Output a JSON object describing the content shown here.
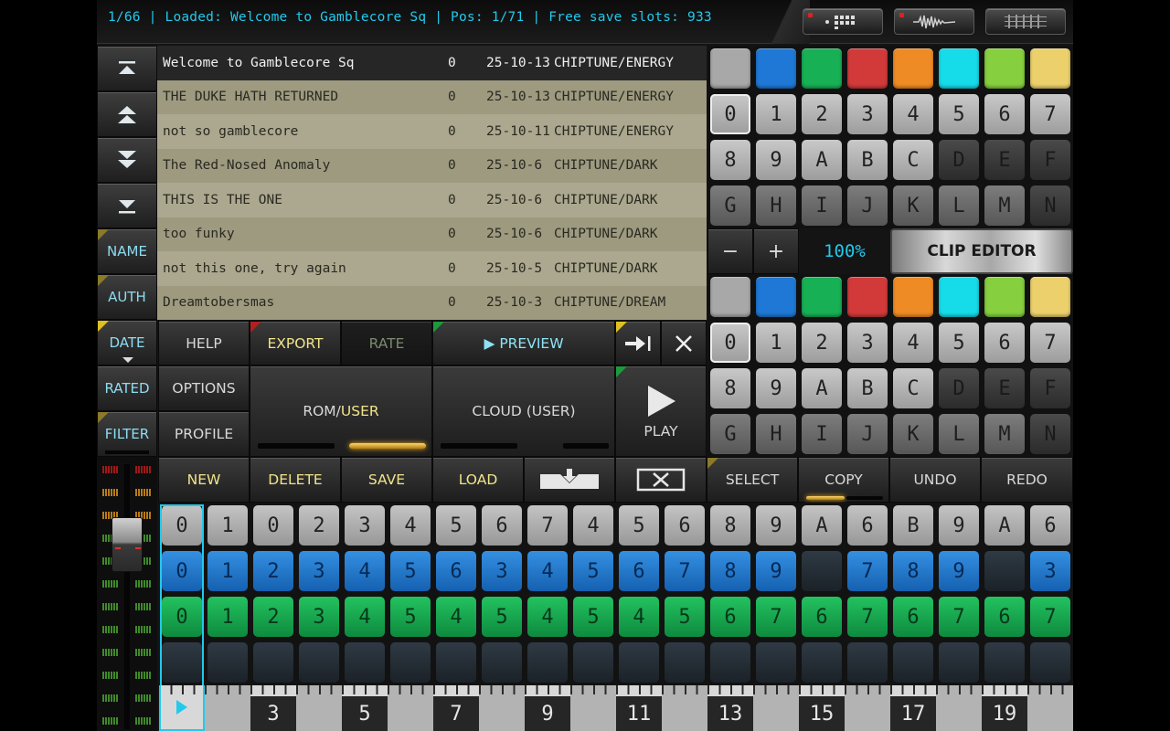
{
  "status": {
    "text": "1/66 | Loaded: Welcome to Gamblecore Sq | Pos: 1/71 | Free save slots: 933"
  },
  "top_buttons": [
    {
      "name": "song-mode-button",
      "icon": "dot-grid-icon"
    },
    {
      "name": "sample-mode-button",
      "icon": "waveform-icon"
    },
    {
      "name": "tracker-mode-button",
      "icon": "pattern-grid-icon"
    }
  ],
  "sidebar": {
    "sort_labels": [
      "NAME",
      "AUTH",
      "DATE",
      "RATED",
      "FILTER"
    ]
  },
  "songs": [
    {
      "name": "Welcome to Gamblecore Sq",
      "rating": "0",
      "date": "25-10-13",
      "genre": "CHIPTUNE/ENERGY"
    },
    {
      "name": "THE DUKE HATH RETURNED",
      "rating": "0",
      "date": "25-10-13",
      "genre": "CHIPTUNE/ENERGY"
    },
    {
      "name": "not so gamblecore",
      "rating": "0",
      "date": "25-10-11",
      "genre": "CHIPTUNE/ENERGY"
    },
    {
      "name": "The Red-Nosed Anomaly",
      "rating": "0",
      "date": "25-10-6",
      "genre": "CHIPTUNE/DARK"
    },
    {
      "name": "THIS IS THE ONE",
      "rating": "0",
      "date": "25-10-6",
      "genre": "CHIPTUNE/DARK"
    },
    {
      "name": "too funky",
      "rating": "0",
      "date": "25-10-6",
      "genre": "CHIPTUNE/DARK"
    },
    {
      "name": "not this one, try again",
      "rating": "0",
      "date": "25-10-5",
      "genre": "CHIPTUNE/DARK"
    },
    {
      "name": "Dreamtobersmas",
      "rating": "0",
      "date": "25-10-3",
      "genre": "CHIPTUNE/DREAM"
    }
  ],
  "actions": {
    "help": "HELP",
    "export": "EXPORT",
    "rate": "RATE",
    "preview": "▶ PREVIEW",
    "options": "OPTIONS",
    "profile": "PROFILE",
    "rom_user_prefix": "ROM/",
    "rom_user_suffix": "USER",
    "cloud": "CLOUD (USER)",
    "play": "PLAY"
  },
  "edit_actions": {
    "new": "NEW",
    "delete": "DELETE",
    "save": "SAVE",
    "load": "LOAD",
    "select": "SELECT",
    "copy": "COPY",
    "undo": "UNDO",
    "redo": "REDO"
  },
  "palette": {
    "colors": [
      "#a8a8a8",
      "#1f78d6",
      "#18b055",
      "#d23a3a",
      "#ef8b24",
      "#16dbe9",
      "#86cf3e",
      "#ecd06c"
    ],
    "keys": [
      "0",
      "1",
      "2",
      "3",
      "4",
      "5",
      "6",
      "7",
      "8",
      "9",
      "A",
      "B",
      "C",
      "D",
      "E",
      "F",
      "G",
      "H",
      "I",
      "J",
      "K",
      "L",
      "M",
      "N"
    ],
    "zoom": "100%",
    "minus": "−",
    "plus": "+",
    "clip_editor": "CLIP EDITOR"
  },
  "pattern": {
    "rows": [
      {
        "color": "gray",
        "cells": [
          "0",
          "1",
          "0",
          "2",
          "3",
          "4",
          "5",
          "6",
          "7",
          "4",
          "5",
          "6",
          "8",
          "9",
          "A",
          "6",
          "B",
          "9",
          "A",
          "6"
        ]
      },
      {
        "color": "blue",
        "cells": [
          "0",
          "1",
          "2",
          "3",
          "4",
          "5",
          "6",
          "3",
          "4",
          "5",
          "6",
          "7",
          "8",
          "9",
          "",
          "7",
          "8",
          "9",
          "",
          "3"
        ]
      },
      {
        "color": "green",
        "cells": [
          "0",
          "1",
          "2",
          "3",
          "4",
          "5",
          "4",
          "5",
          "4",
          "5",
          "4",
          "5",
          "6",
          "7",
          "6",
          "7",
          "6",
          "7",
          "6",
          "7"
        ]
      },
      {
        "color": "empty",
        "cells": [
          "",
          "",
          "",
          "",
          "",
          "",
          "",
          "",
          "",
          "",
          "",
          "",
          "",
          "",
          "",
          "",
          "",
          "",
          "",
          ""
        ]
      }
    ]
  },
  "ruler": {
    "labels": [
      "3",
      "5",
      "7",
      "9",
      "11",
      "13",
      "15",
      "17",
      "19"
    ]
  }
}
